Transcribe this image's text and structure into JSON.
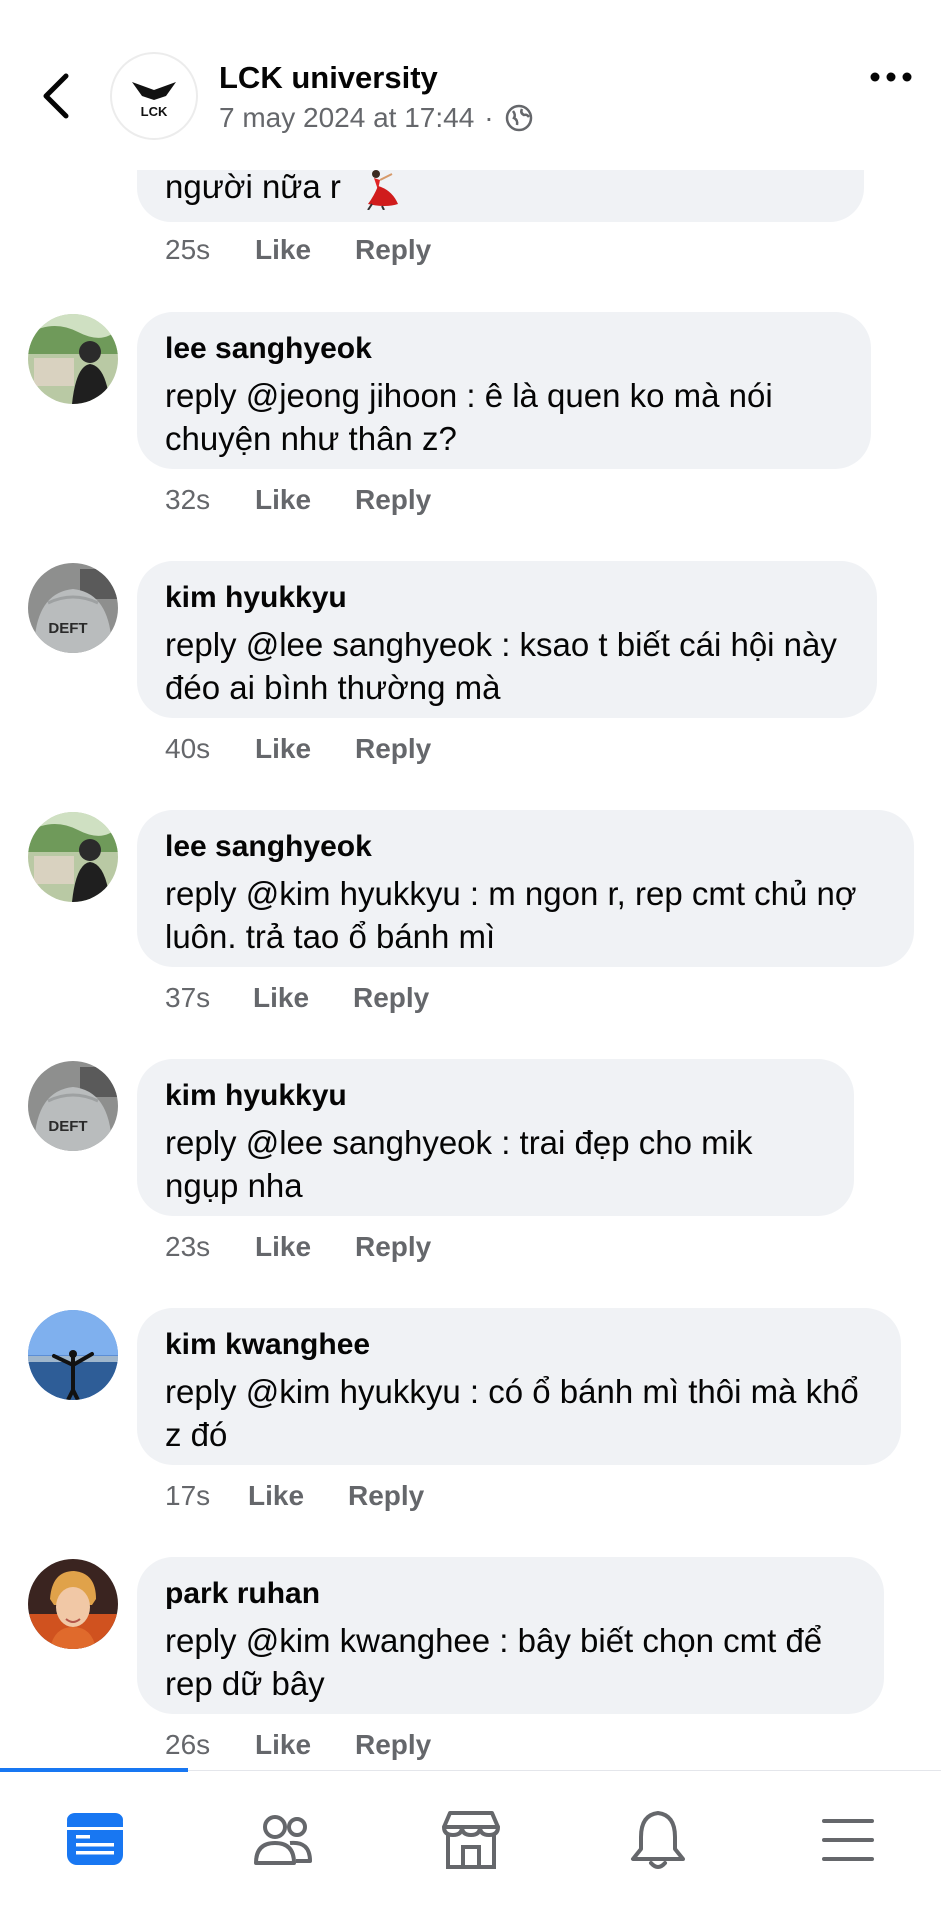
{
  "header": {
    "page_name": "LCK university",
    "post_date": "7 may 2024 at 17:44",
    "separator": "·"
  },
  "top_comment": {
    "text_tail": "người nữa r",
    "time": "25s",
    "like": "Like",
    "reply": "Reply"
  },
  "comments": [
    {
      "author": "lee sanghyeok",
      "text": "reply @jeong jihoon : ê là quen ko mà nói chuyện như thân z?",
      "time": "32s",
      "like": "Like",
      "reply": "Reply"
    },
    {
      "author": "kim hyukkyu",
      "text": "reply @lee sanghyeok : ksao t biết cái hội này đéo ai bình thường mà",
      "time": "40s",
      "like": "Like",
      "reply": "Reply"
    },
    {
      "author": "lee sanghyeok",
      "text": "reply @kim hyukkyu : m ngon r, rep cmt chủ nợ luôn. trả tao ổ bánh mì",
      "time": "37s",
      "like": "Like",
      "reply": "Reply"
    },
    {
      "author": "kim hyukkyu",
      "text": "reply @lee sanghyeok : trai đẹp cho mik ngụp nha",
      "time": "23s",
      "like": "Like",
      "reply": "Reply"
    },
    {
      "author": "kim kwanghee",
      "text": "reply @kim hyukkyu : có ổ bánh mì thôi mà khổ z đó",
      "time": "17s",
      "like": "Like",
      "reply": "Reply"
    },
    {
      "author": "park ruhan",
      "text": "reply @kim kwanghee : bây biết chọn cmt để rep dữ bây",
      "time": "26s",
      "like": "Like",
      "reply": "Reply"
    }
  ],
  "avatar_labels": {
    "deft_1": "DEFT",
    "deft_2": "DEFT",
    "logo": "LCK"
  },
  "bottom_nav": [
    "feed-icon",
    "friends-icon",
    "marketplace-icon",
    "notifications-icon",
    "menu-icon"
  ],
  "colors": {
    "accent": "#1877f2",
    "bubble": "#f0f2f5",
    "secondary_text": "#65676b"
  }
}
